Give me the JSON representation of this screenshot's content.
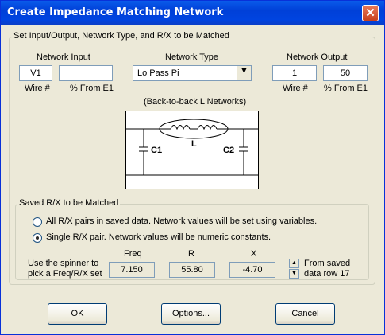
{
  "window": {
    "title": "Create Impedance Matching Network"
  },
  "main_group": {
    "legend": "Set Input/Output, Network Type, and R/X to be Matched"
  },
  "network_input": {
    "heading": "Network Input",
    "wire_value": "V1",
    "percent_value": "",
    "wire_label": "Wire #",
    "percent_label": "% From E1"
  },
  "network_type": {
    "heading": "Network Type",
    "selected": "Lo Pass Pi",
    "arrow": "▼"
  },
  "network_output": {
    "heading": "Network Output",
    "wire_value": "1",
    "percent_value": "50",
    "wire_label": "Wire #",
    "percent_label": "% From E1"
  },
  "diagram": {
    "caption": "(Back-to-back L Networks)",
    "l_label": "L",
    "c1_label": "C1",
    "c2_label": "C2"
  },
  "saved_group": {
    "legend": "Saved R/X to be Matched",
    "option_all": "All R/X pairs in saved data.  Network values will be set using variables.",
    "option_single": "Single R/X pair.  Network values will be numeric constants.",
    "selected_option": "single",
    "spinner_hint_line1": "Use the spinner to",
    "spinner_hint_line2": "pick a Freq/R/X set",
    "freq_label": "Freq",
    "r_label": "R",
    "x_label": "X",
    "freq_value": "7.150",
    "r_value": "55.80",
    "x_value": "-4.70",
    "source_line1": "From saved",
    "source_line2": "data row 17"
  },
  "buttons": {
    "ok": "OK",
    "options": "Options...",
    "cancel": "Cancel"
  },
  "icons": {
    "close": "close-icon",
    "spin_up": "arrow-up-icon",
    "spin_down": "arrow-down-icon",
    "dropdown": "chevron-down-icon"
  },
  "colors": {
    "titlebar": "#0a5bea",
    "dialog_bg": "#ece9d8",
    "field_border": "#7f9db9"
  }
}
